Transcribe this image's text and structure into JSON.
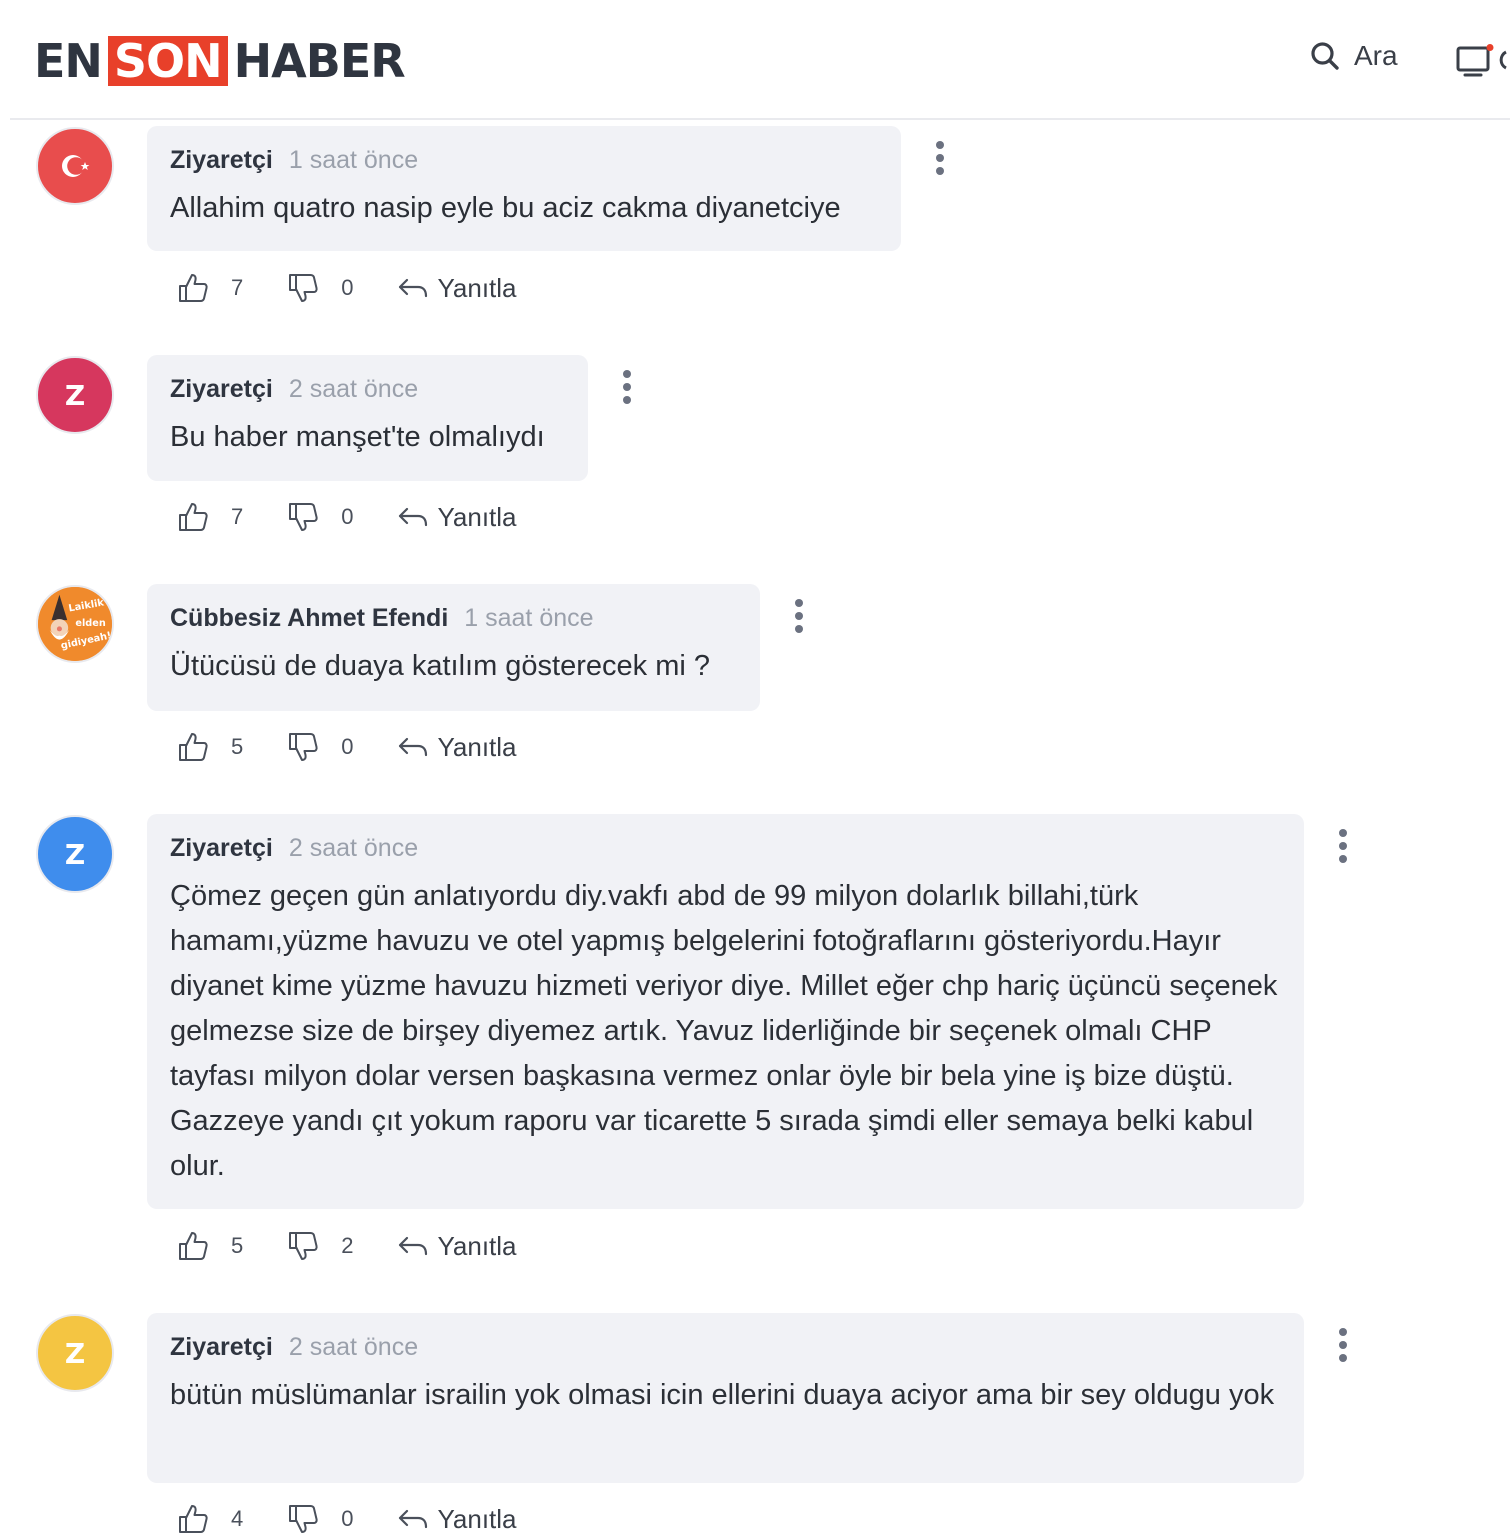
{
  "header": {
    "logo": {
      "part1": "EN",
      "part2": "SON",
      "part3": "HABER"
    },
    "search_label": "Ara",
    "icons": [
      "search-icon",
      "tv-icon"
    ],
    "brand_color": "#e8402a"
  },
  "comments": [
    {
      "author": "Ziyaretçi",
      "time": "1 saat önce",
      "text": "Allahim quatro nasip eyle bu aciz cakma diyanetciye",
      "likes": "7",
      "dislikes": "0",
      "reply_label": "Yanıtla",
      "avatar": {
        "type": "flag",
        "color": "#e84d4d"
      }
    },
    {
      "author": "Ziyaretçi",
      "time": "2 saat önce",
      "text": "Bu haber manşet'te olmalıydı",
      "likes": "7",
      "dislikes": "0",
      "reply_label": "Yanıtla",
      "avatar": {
        "type": "letter",
        "letter": "Z",
        "color": "#d6375e"
      }
    },
    {
      "author": "Cübbesiz Ahmet Efendi",
      "time": "1 saat önce",
      "text": "Ütücüsü de duaya katılım gösterecek mi ?",
      "likes": "5",
      "dislikes": "0",
      "reply_label": "Yanıtla",
      "avatar": {
        "type": "image",
        "color": "#f08a2c",
        "lines": [
          "Laiklik",
          "elden",
          "gidiyeah!"
        ]
      }
    },
    {
      "author": "Ziyaretçi",
      "time": "2 saat önce",
      "text": "Çömez geçen gün anlatıyordu diy.vakfı abd de 99 milyon dolarlık billahi,türk hamamı,yüzme havuzu ve otel yapmış belgelerini fotoğraflarını gösteriyordu.Hayır diyanet kime yüzme havuzu hizmeti veriyor diye. Millet eğer chp hariç üçüncü seçenek gelmezse size de birşey diyemez artık. Yavuz liderliğinde bir seçenek olmalı CHP tayfası milyon dolar versen başkasına vermez onlar öyle bir bela yine iş bize düştü. Gazzeye yandı çıt yokum raporu var ticarette 5 sırada şimdi eller semaya belki kabul olur.",
      "likes": "5",
      "dislikes": "2",
      "reply_label": "Yanıtla",
      "avatar": {
        "type": "letter",
        "letter": "Z",
        "color": "#3f8ded"
      }
    },
    {
      "author": "Ziyaretçi",
      "time": "2 saat önce",
      "text": "bütün müslümanlar israilin yok olmasi icin ellerini duaya aciyor ama bir sey oldugu yok",
      "likes": "4",
      "dislikes": "0",
      "reply_label": "Yanıtla",
      "avatar": {
        "type": "letter",
        "letter": "Z",
        "color": "#f4c542"
      }
    }
  ]
}
